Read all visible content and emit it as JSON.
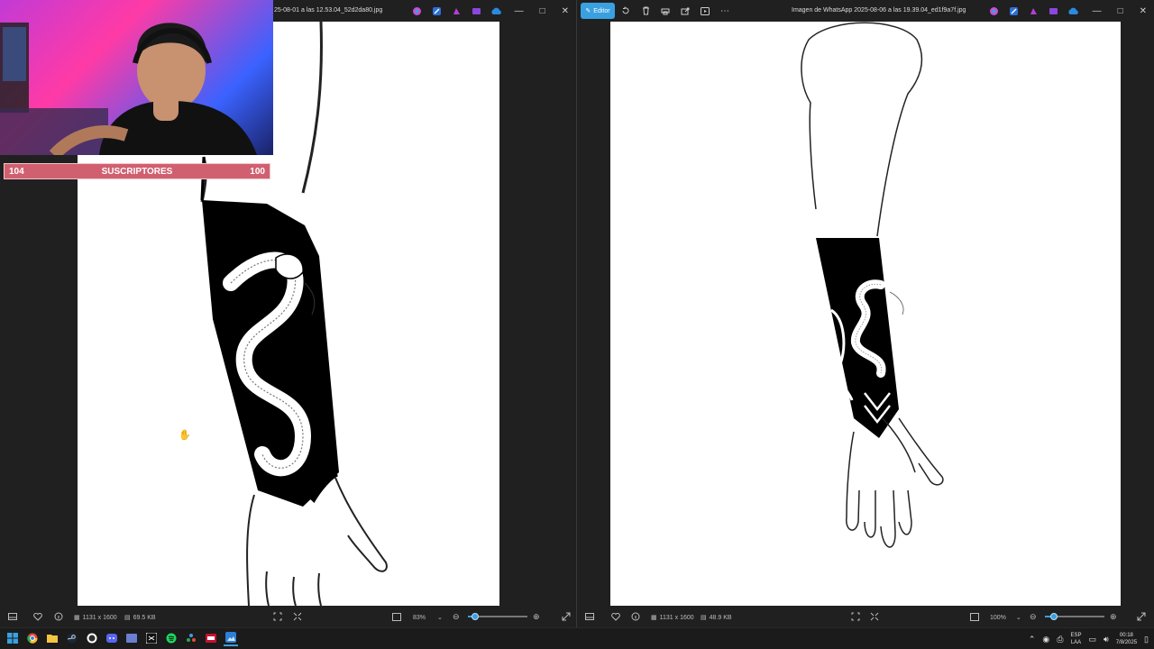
{
  "left_viewer": {
    "title": "25-08-01 a las 12.53.04_52d2da80.jpg",
    "status": {
      "dimensions": "1131 x 1600",
      "filesize": "69.5 KB",
      "zoom": "83%",
      "zoom_fraction": 0.12
    }
  },
  "right_viewer": {
    "editor_label": "Editor",
    "title": "Imagen de WhatsApp 2025-08-06 a las 19.39.04_ed1f9a7f.jpg",
    "status": {
      "dimensions": "1131 x 1600",
      "filesize": "48.9 KB",
      "zoom": "100%",
      "zoom_fraction": 0.15
    }
  },
  "overlay": {
    "sub_left": "104",
    "sub_label": "SUSCRIPTORES",
    "sub_right": "100"
  },
  "window_controls": {
    "minimize": "—",
    "maximize": "□",
    "close": "✕"
  },
  "taskbar": {
    "apps": [
      "start-icon",
      "chrome-icon",
      "file-explorer-icon",
      "steam-icon",
      "obs-icon",
      "discord-icon",
      "editor-app-icon",
      "capcut-icon",
      "spotify-icon",
      "stream-deck-icon",
      "recorder-icon",
      "photos-icon"
    ],
    "lang_top": "ESP",
    "lang_bottom": "LAA",
    "time": "00:18",
    "date": "7/8/2025"
  },
  "colors": {
    "accent": "#3aa0e0",
    "sub_bar": "#d06070"
  }
}
